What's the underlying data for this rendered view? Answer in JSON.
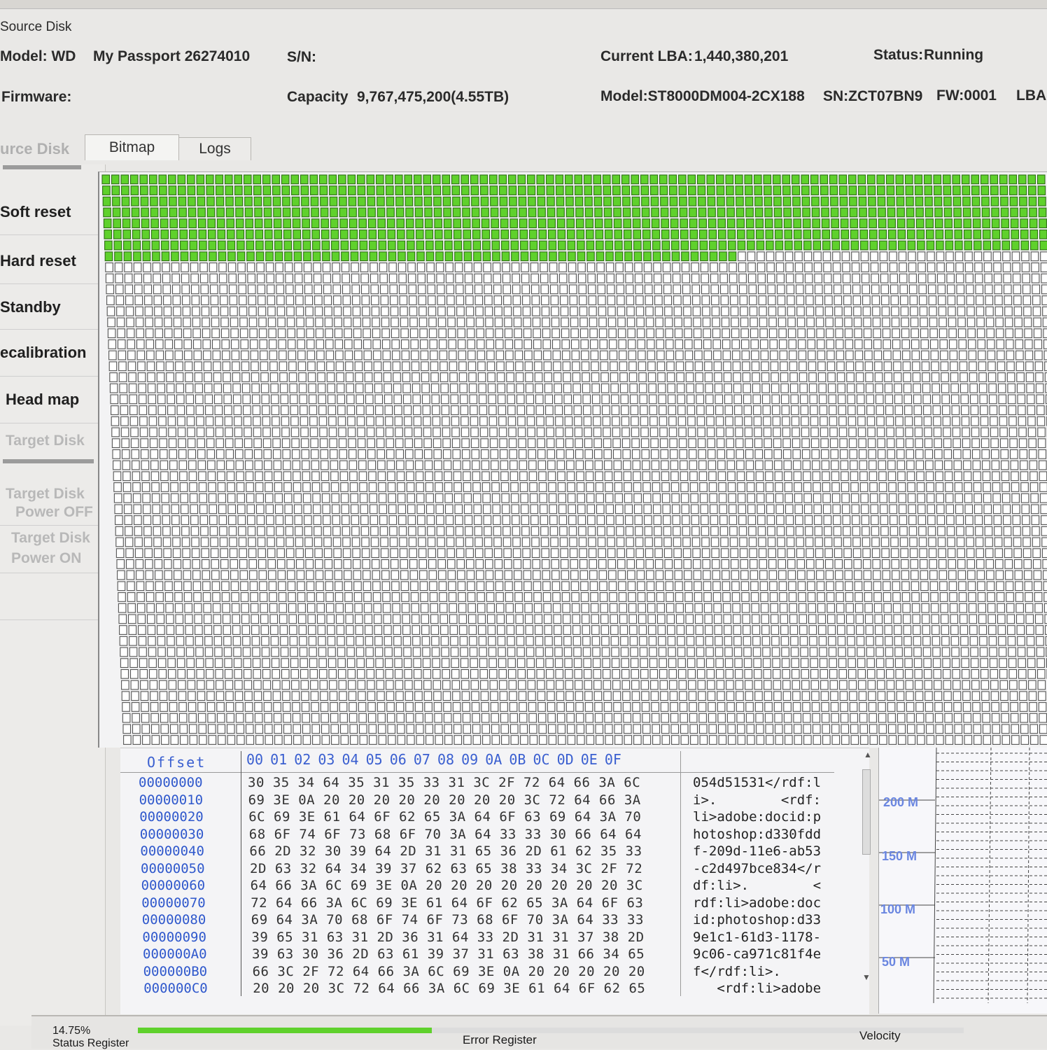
{
  "source_disk": {
    "title": "Source Disk",
    "model_label": "Model: WD",
    "model_value": "My Passport 26274010",
    "sn_label": "S/N:",
    "current_lba_label": "Current LBA:",
    "current_lba_value": "1,440,380,201",
    "status_label": "Status:",
    "status_value": "Running",
    "firmware_label": "Firmware:",
    "capacity_label": "Capacity",
    "capacity_value": "9,767,475,200(4.55TB)",
    "target_model": "Model:ST8000DM004-2CX188",
    "target_sn": "SN:ZCT07BN9",
    "target_fw": "FW:0001",
    "target_lba": "LBA:"
  },
  "left_panel": {
    "source_disk_header": "urce Disk",
    "soft_reset": "Soft reset",
    "hard_reset": "Hard reset",
    "standby": "Standby",
    "recalibration": "ecalibration",
    "head_map": "Head map",
    "target_disk_header": "Target Disk",
    "target_power_off_line1": "Target Disk",
    "target_power_off_line2": "Power OFF",
    "target_power_on_line1": "Target Disk",
    "target_power_on_line2": "Power ON"
  },
  "tabs": [
    {
      "label": "Bitmap",
      "active": true
    },
    {
      "label": "Logs",
      "active": false
    }
  ],
  "bitmap": {
    "filled_color": "#5fd12c",
    "empty_color": "#ffffff",
    "progress_fraction": 0.1475
  },
  "hex": {
    "offset_header": "Offset",
    "byte_headers": "00 01 02 03 04 05 06 07 08 09 0A 0B 0C 0D 0E 0F",
    "rows": [
      {
        "offset": "00000000",
        "hex": "30 35 34 64 35 31 35 33 31 3C 2F 72 64 66 3A 6C",
        "ascii": "054d51531</rdf:l"
      },
      {
        "offset": "00000010",
        "hex": "69 3E 0A 20 20 20 20 20 20 20 20 3C 72 64 66 3A",
        "ascii": "i>.        <rdf:"
      },
      {
        "offset": "00000020",
        "hex": "6C 69 3E 61 64 6F 62 65 3A 64 6F 63 69 64 3A 70",
        "ascii": "li>adobe:docid:p"
      },
      {
        "offset": "00000030",
        "hex": "68 6F 74 6F 73 68 6F 70 3A 64 33 33 30 66 64 64",
        "ascii": "hotoshop:d330fdd"
      },
      {
        "offset": "00000040",
        "hex": "66 2D 32 30 39 64 2D 31 31 65 36 2D 61 62 35 33",
        "ascii": "f-209d-11e6-ab53"
      },
      {
        "offset": "00000050",
        "hex": "2D 63 32 64 34 39 37 62 63 65 38 33 34 3C 2F 72",
        "ascii": "-c2d497bce834</r"
      },
      {
        "offset": "00000060",
        "hex": "64 66 3A 6C 69 3E 0A 20 20 20 20 20 20 20 20 3C",
        "ascii": "df:li>.        <"
      },
      {
        "offset": "00000070",
        "hex": "72 64 66 3A 6C 69 3E 61 64 6F 62 65 3A 64 6F 63",
        "ascii": "rdf:li>adobe:doc"
      },
      {
        "offset": "00000080",
        "hex": "69 64 3A 70 68 6F 74 6F 73 68 6F 70 3A 64 33 33",
        "ascii": "id:photoshop:d33"
      },
      {
        "offset": "00000090",
        "hex": "39 65 31 63 31 2D 36 31 64 33 2D 31 31 37 38 2D",
        "ascii": "9e1c1-61d3-1178-"
      },
      {
        "offset": "000000A0",
        "hex": "39 63 30 36 2D 63 61 39 37 31 63 38 31 66 34 65",
        "ascii": "9c06-ca971c81f4e"
      },
      {
        "offset": "000000B0",
        "hex": "66 3C 2F 72 64 66 3A 6C 69 3E 0A 20 20 20 20 20",
        "ascii": "f</rdf:li>."
      },
      {
        "offset": "000000C0",
        "hex": "20 20 20 3C 72 64 66 3A 6C 69 3E 61 64 6F 62 65",
        "ascii": "   <rdf:li>adobe"
      }
    ]
  },
  "graph": {
    "labels": [
      "200 M",
      "150 M",
      "100 M",
      "50 M"
    ],
    "label_color": "#6a86e0"
  },
  "status_bar": {
    "percent": "14.75%",
    "progress_fraction": 0.1475,
    "progress_color": "#5fd12c",
    "status_register_label": "Status Register",
    "error_register_label": "Error Register",
    "velocity_label": "Velocity"
  }
}
